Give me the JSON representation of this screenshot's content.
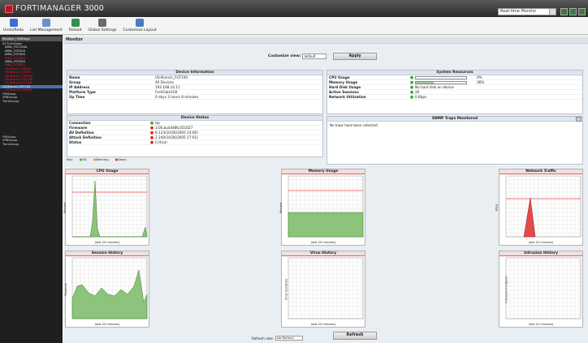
{
  "app": {
    "title": "FORTIMANAGER",
    "version": "3000",
    "mode_select": "Real-time Monitor"
  },
  "toolbar": [
    {
      "label": "Undo/Redo",
      "color": "#3b6fd6"
    },
    {
      "label": "List Management",
      "color": "#6c8fc4"
    },
    {
      "label": "Reload",
      "color": "#2f8f4f"
    },
    {
      "label": "Global Settings",
      "color": "#6a6a6a"
    },
    {
      "label": "Customize Layout",
      "color": "#4a7ac0"
    }
  ],
  "sidebar": {
    "tabs": "Monitor | Settings",
    "items": [
      {
        "label": "All FortiGates",
        "cls": ""
      },
      {
        "label": "APAC_FGT100A",
        "cls": "sub"
      },
      {
        "label": "APAC_FGT200",
        "cls": "sub"
      },
      {
        "label": "APAC_FGT400",
        "cls": "sub"
      },
      {
        "label": "APAC_FGT500",
        "cls": "red"
      },
      {
        "label": "APAC_FGT300",
        "cls": "sub"
      },
      {
        "label": "APAC_FGT600",
        "cls": "red"
      },
      {
        "label": "US-Branch_FGT50",
        "cls": "red"
      },
      {
        "label": "US-Branch_FGT60",
        "cls": "red"
      },
      {
        "label": "US-Branch_FGT100",
        "cls": "red"
      },
      {
        "label": "US-Branch_FGT200",
        "cls": "red"
      },
      {
        "label": "US-Branch_FGT300",
        "cls": "red"
      },
      {
        "label": "US-Branch_FGT100",
        "cls": "sel"
      },
      {
        "label": "US-Branch_FGT500",
        "cls": "red"
      },
      {
        "label": "FWGroup",
        "cls": ""
      },
      {
        "label": "VPNGroup",
        "cls": ""
      },
      {
        "label": "TransGroup",
        "cls": ""
      }
    ],
    "lower_items": [
      "FWGroup",
      "VPNGroup",
      "TransGroup"
    ]
  },
  "monitor": {
    "header": "Monitor",
    "customize_label": "Customize view:",
    "customize_value": "default",
    "apply": "Apply",
    "refresh_label": "Refresh rate:",
    "refresh_value": "No Refresh",
    "refresh_btn": "Refresh"
  },
  "device_info": {
    "title": "Device Information",
    "rows": [
      {
        "k": "Name",
        "v": "US-Branch_FGT100"
      },
      {
        "k": "Group",
        "v": "All Devices"
      },
      {
        "k": "IP Address",
        "v": "192.168.14.11"
      },
      {
        "k": "Platform Type",
        "v": "FortiGate100"
      },
      {
        "k": "Up Time",
        "v": "0 days 3 hours 8 minutes"
      }
    ]
  },
  "device_status": {
    "title": "Device Status",
    "rows": [
      {
        "k": "Connection",
        "v": "Up",
        "dot": "g"
      },
      {
        "k": "Firmware",
        "v": "3.00,build486,051027",
        "dot": "r"
      },
      {
        "k": "AV Definition",
        "v": "6.133(10/26/2005 14:00)",
        "dot": "r"
      },
      {
        "k": "Attack Definition",
        "v": "2.240(10/26/2005 17:01)",
        "dot": "r"
      },
      {
        "k": "Status",
        "v": "Critical",
        "dot": "r"
      }
    ],
    "legend": [
      "Key:",
      "OK",
      "Warning",
      "Down"
    ]
  },
  "system_resources": {
    "title": "System Resources",
    "rows": [
      {
        "k": "CPU Usage",
        "v": "0%",
        "bar": 0
      },
      {
        "k": "Memory Usage",
        "v": "36%",
        "bar": 0.36
      },
      {
        "k": "Hard Disk Usage",
        "v": "No hard disk on device"
      },
      {
        "k": "Active Sessions",
        "v": "26"
      },
      {
        "k": "Network Utilization",
        "v": "0 Kbps"
      }
    ]
  },
  "snmp": {
    "title": "SNMP Traps Monitored",
    "text": "No traps have been collected."
  },
  "charts": [
    {
      "title": "CPU Usage",
      "ylabel": "Percent",
      "xlabel": "(last 20 minutes)"
    },
    {
      "title": "Memory Usage",
      "ylabel": "Percent",
      "xlabel": "(last 20 minutes)"
    },
    {
      "title": "Network Traffic",
      "ylabel": "Kbps",
      "xlabel": "(last 20 minutes)"
    },
    {
      "title": "Session History",
      "ylabel": "Sessions",
      "xlabel": "(last 20 minutes)"
    },
    {
      "title": "Virus History",
      "ylabel": "Virus Incidents",
      "xlabel": "(last 20 minutes)"
    },
    {
      "title": "Intrusion History",
      "ylabel": "Intrusion Incidents",
      "xlabel": "(last 20 minutes)"
    }
  ],
  "colors": {
    "red": "#c0141b",
    "green": "#8bc47a",
    "chart_fill_red": "#e34b4b"
  }
}
